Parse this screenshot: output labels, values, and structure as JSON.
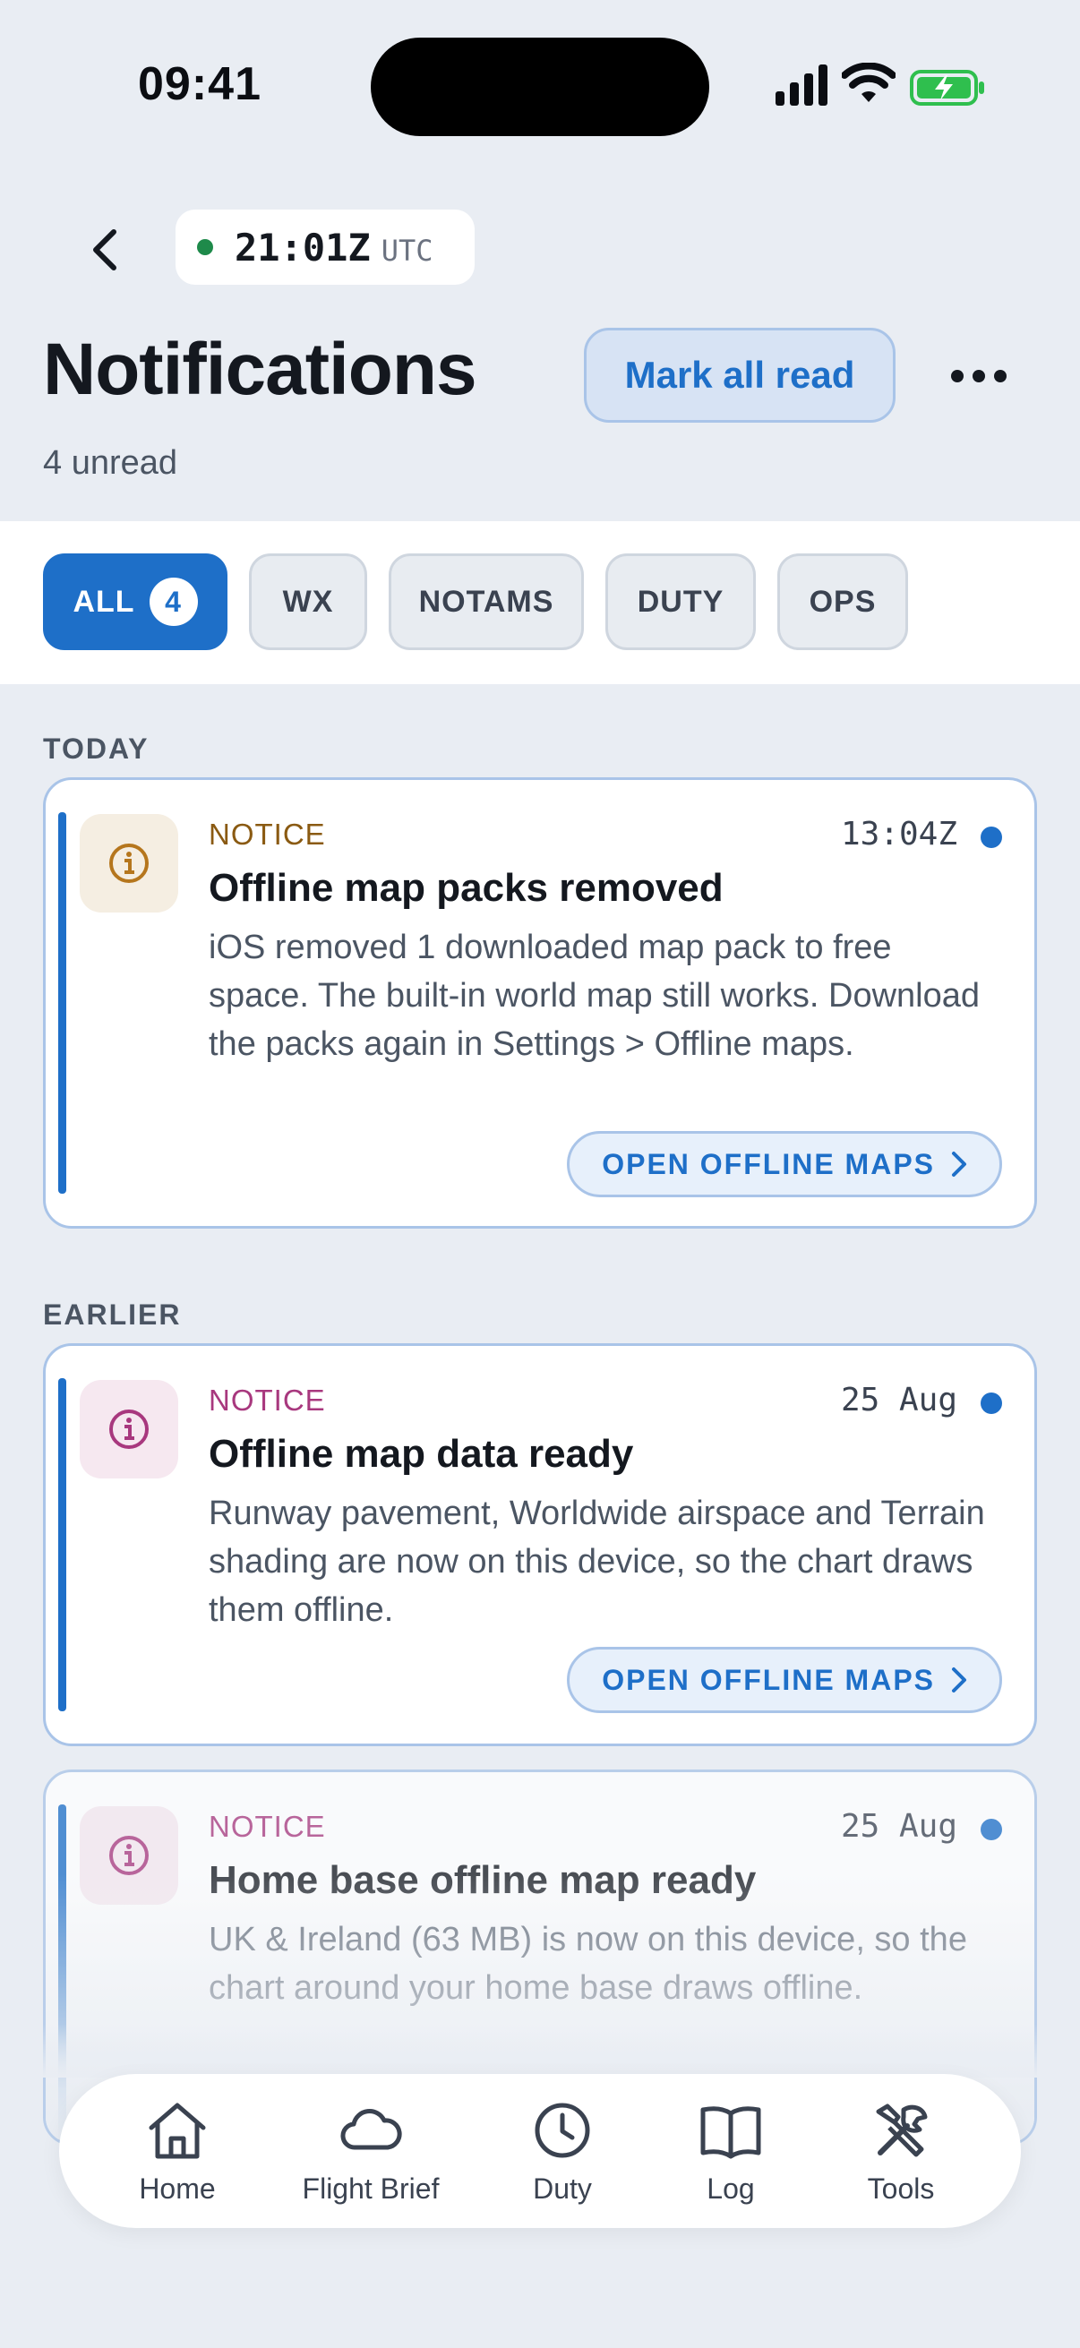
{
  "status_bar": {
    "time": "09:41"
  },
  "header": {
    "utc_time": "21:01Z",
    "utc_label": "UTC",
    "title": "Notifications",
    "unread_text": "4 unread",
    "mark_all_read": "Mark all read"
  },
  "filters": {
    "items": [
      {
        "label": "ALL",
        "count": "4",
        "active": true
      },
      {
        "label": "WX"
      },
      {
        "label": "NOTAMS"
      },
      {
        "label": "DUTY"
      },
      {
        "label": "OPS"
      }
    ]
  },
  "sections": {
    "today": "TODAY",
    "earlier": "EARLIER"
  },
  "notifications": [
    {
      "kind": "NOTICE",
      "time": "13:04Z",
      "title": "Offline map packs removed",
      "body": "iOS removed 1 downloaded map pack to free space. The built-in world map still works. Download the packs again in Settings > Offline maps.",
      "action": "OPEN OFFLINE MAPS",
      "icon": "info-icon",
      "accent": "#b5761d",
      "unread": true
    },
    {
      "kind": "NOTICE",
      "time": "25 Aug",
      "title": "Offline map data ready",
      "body": "Runway pavement, Worldwide airspace and Terrain shading are now on this device, so the chart draws them offline.",
      "action": "OPEN OFFLINE MAPS",
      "icon": "info-icon",
      "accent": "#a8387e",
      "unread": true
    },
    {
      "kind": "NOTICE",
      "time": "25 Aug",
      "title": "Home base offline map ready",
      "body": "UK & Ireland (63 MB) is now on this device, so the chart around your home base draws offline.",
      "icon": "info-icon",
      "accent": "#a8387e",
      "unread": true
    }
  ],
  "tabbar": {
    "items": [
      {
        "label": "Home",
        "icon": "home-icon"
      },
      {
        "label": "Flight Brief",
        "icon": "cloud-icon"
      },
      {
        "label": "Duty",
        "icon": "clock-icon"
      },
      {
        "label": "Log",
        "icon": "book-icon"
      },
      {
        "label": "Tools",
        "icon": "tools-icon"
      }
    ]
  },
  "colors": {
    "accent": "#1e6fc8",
    "background": "#e9edf3",
    "utc_dot": "#1e8a4a"
  }
}
